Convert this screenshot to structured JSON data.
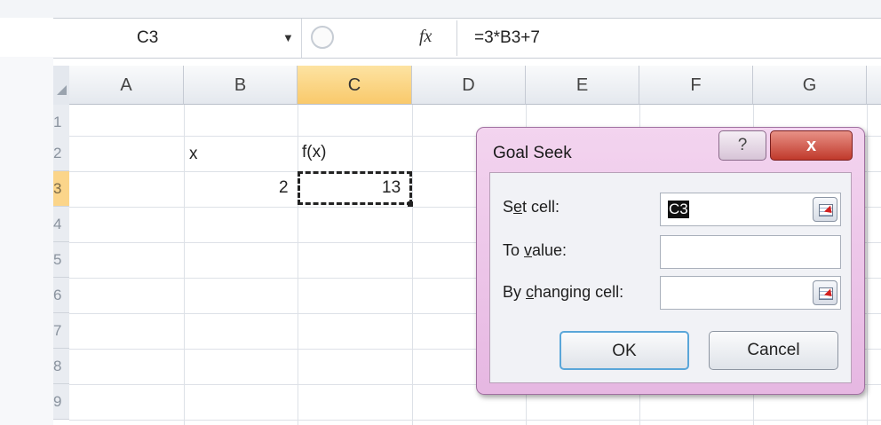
{
  "formula_bar": {
    "name_box": "C3",
    "fx_label": "fx",
    "formula": "=3*B3+7"
  },
  "columns": [
    "A",
    "B",
    "C",
    "D",
    "E",
    "F",
    "G"
  ],
  "rows": [
    "1",
    "2",
    "3",
    "4",
    "5",
    "6",
    "7",
    "8",
    "9"
  ],
  "cells": {
    "B2": "x",
    "C2": "f(x)",
    "B3": "2",
    "C3": "13"
  },
  "active_cell": "C3",
  "dialog": {
    "title": "Goal Seek",
    "help_label": "?",
    "close_label": "x",
    "set_cell_label": "Set cell:",
    "set_cell_value": "C3",
    "to_value_label": "To value:",
    "to_value_value": "",
    "by_changing_label": "By changing cell:",
    "by_changing_value": "",
    "ok_label": "OK",
    "cancel_label": "Cancel"
  },
  "colors": {
    "active_header": "#f9c96b",
    "dialog_frame": "#e6b7e2",
    "close_button": "#c0392b",
    "ok_border": "#5aa6d9"
  }
}
